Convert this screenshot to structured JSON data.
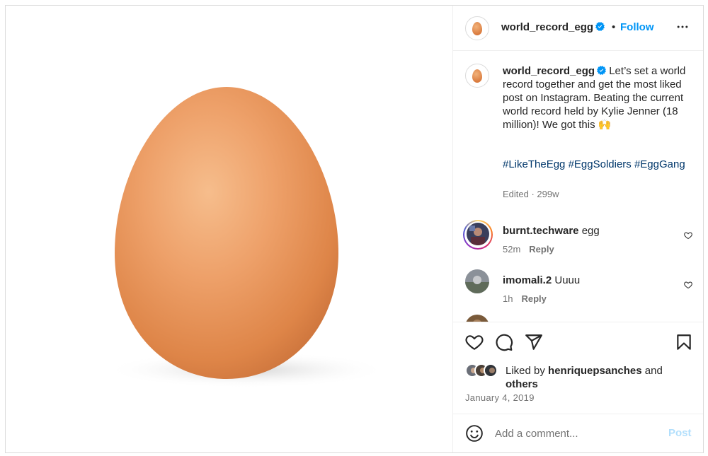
{
  "post": {
    "username": "world_record_egg",
    "follow_label": "Follow",
    "separator": "•",
    "caption_text": "Let’s set a world record together and get the most liked post on Instagram. Beating the current world record held by Kylie Jenner (18 million)! We got this 🙌",
    "hashtags": "#LikeTheEgg #EggSoldiers #EggGang",
    "edited_label": "Edited · 299w"
  },
  "comments": [
    {
      "username": "burnt.techware",
      "text": "egg",
      "time": "52m",
      "reply_label": "Reply"
    },
    {
      "username": "imomali.2",
      "text": "Uuuu",
      "time": "1h",
      "reply_label": "Reply"
    }
  ],
  "likes": {
    "prefix": "Liked by",
    "user": "henriquepsanches",
    "conjunction": "and",
    "others": "others"
  },
  "date": "January 4, 2019",
  "composer": {
    "placeholder": "Add a comment...",
    "post_label": "Post"
  },
  "icons": {
    "more": "more-icon",
    "like": "heart-icon",
    "comment": "comment-icon",
    "share": "share-icon",
    "save": "bookmark-icon",
    "emoji": "emoji-icon",
    "verified": "verified-badge-icon"
  },
  "colors": {
    "accent": "#0095f6",
    "hashtag": "#00376b",
    "muted": "#737373",
    "egg": "#e89a5e"
  }
}
